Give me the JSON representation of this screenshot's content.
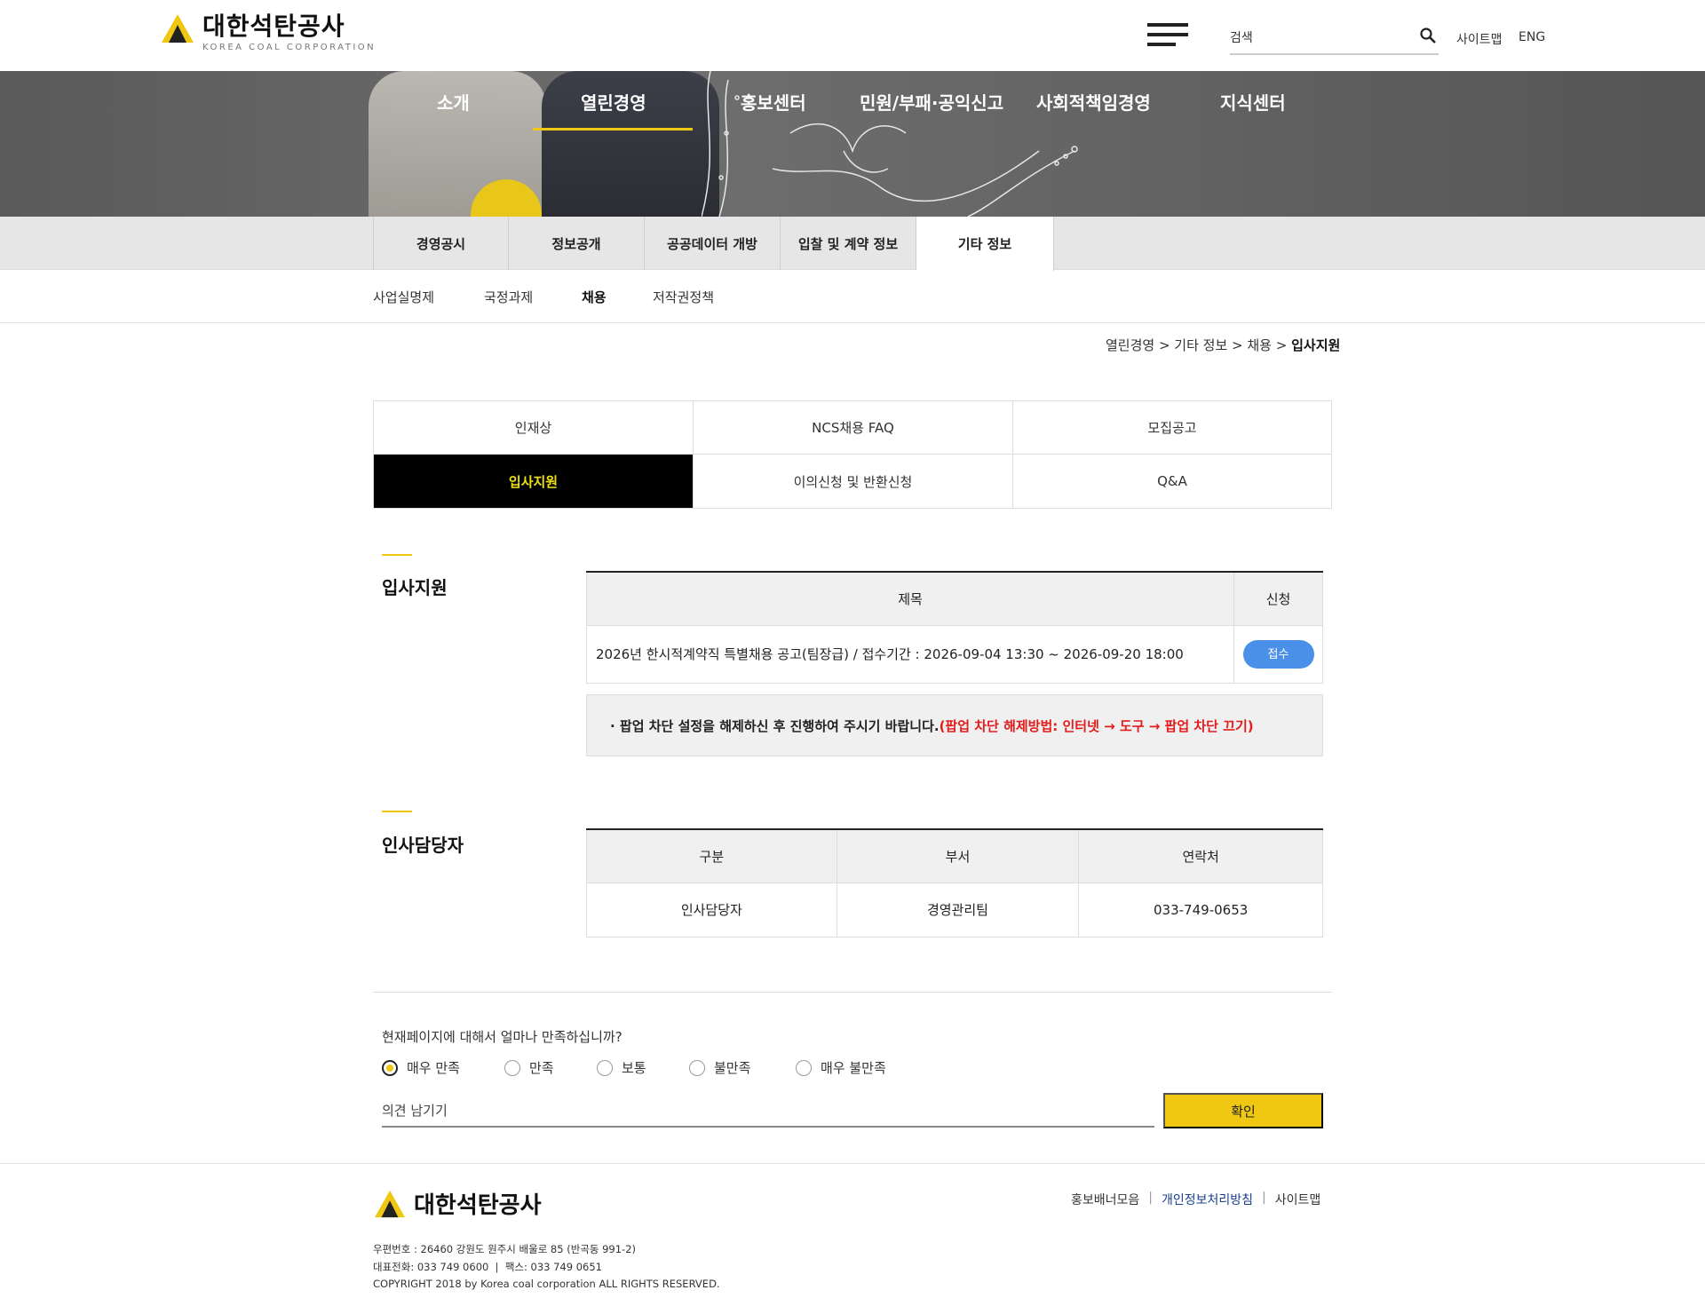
{
  "header": {
    "logo_ko": "대한석탄공사",
    "logo_en": "KOREA COAL CORPORATION",
    "search_placeholder": "검색",
    "sitemap": "사이트맵",
    "eng": "ENG"
  },
  "gnb": [
    "소개",
    "열린경영",
    "홍보센터",
    "민원/부패·공익신고",
    "사회적책임경영",
    "지식센터"
  ],
  "subnav": [
    "경영공시",
    "정보공개",
    "공공데이터 개방",
    "입찰 및 계약 정보",
    "기타 정보"
  ],
  "thirdnav": [
    "사업실명제",
    "국정과제",
    "채용",
    "저작권정책"
  ],
  "breadcrumb": {
    "path": "열린경영 > 기타 정보 > 채용 > ",
    "current": "입사지원"
  },
  "tabs": [
    "인재상",
    "NCS채용 FAQ",
    "모집공고",
    "입사지원",
    "이의신청 및 반환신청",
    "Q&A"
  ],
  "apply_section": {
    "title": "입사지원",
    "headers": [
      "제목",
      "신청"
    ],
    "row_title": "2026년 한시적계약직 특별채용 공고(팀장급) / 접수기간 : 2026-09-04 13:30 ~ 2026-09-20 18:00",
    "row_button": "접수",
    "notice_black": "· 팝업 차단 설정을 해제하신 후 진행하여 주시기 바랍니다.",
    "notice_red": "(팝업 차단 해제방법: 인터넷 → 도구 → 팝업 차단 끄기)"
  },
  "hr_section": {
    "title": "인사담당자",
    "headers": [
      "구분",
      "부서",
      "연락처"
    ],
    "row": [
      "인사담당자",
      "경영관리팀",
      "033-749-0653"
    ]
  },
  "survey": {
    "question": "현재페이지에 대해서 얼마나 만족하십니까?",
    "options": [
      "매우 만족",
      "만족",
      "보통",
      "불만족",
      "매우 불만족"
    ],
    "selected": "매우 만족",
    "opinion_placeholder": "의견 남기기",
    "confirm": "확인"
  },
  "footer": {
    "logo_ko": "대한석탄공사",
    "links": [
      "홍보배너모음",
      "개인정보처리방침",
      "사이트맵"
    ],
    "address": "우편번호 : 26460 강원도 원주시 배울로 85 (반곡동 991-2)",
    "phone": "대표전화: 033 749 0600  |  팩스: 033 749 0651",
    "copyright": "COPYRIGHT 2018 by Korea coal corporation ALL RIGHTS RESERVED."
  },
  "colors": {
    "accent_yellow": "#f0c814",
    "apply_blue": "#4a90e8",
    "notice_red": "#e31b1b"
  }
}
